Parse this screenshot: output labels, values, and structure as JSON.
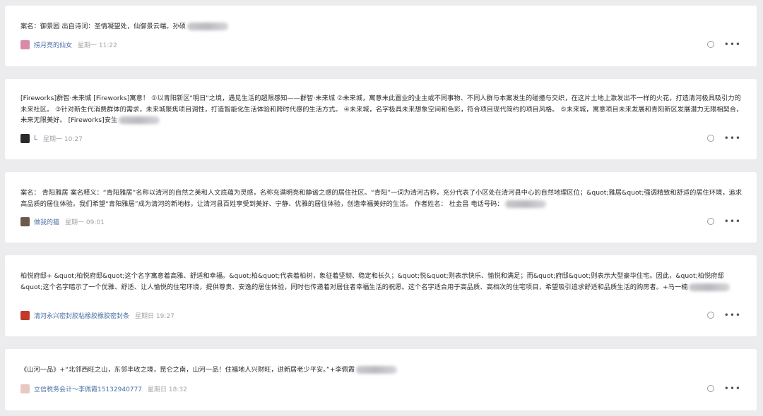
{
  "comments": [
    {
      "text": "案名：御景园 出自诗词：圣情凝望处，仙御景云端。孙硕",
      "author": "捞月亮的仙女",
      "time": "星期一 11:22",
      "avatar_color": "#d98aa8"
    },
    {
      "text": "[Fireworks]群智·未来城 [Fireworks]寓意！ ①以青阳新区\"明日\"之境，遇见生活的超限感知——群智·未来城 ②未来城，寓意未此置业的业主或不同事物、不同人群与本案发生的碰撞与交织，在这片土地上激发出不一样的火花，打造清河极具吸引力的未来社区。 ③针对新生代消费群体的需求，未来城聚焦项目调性，打造智能化生活体验和跨时代感的生活方式。 ④未来城，名字极具未来想象空间和色彩，符合项目现代简约的项目风格。 ⑤未来城，寓意项目未来发展和青阳新区发展潜力无限相契合，未来无限美好。 [Fireworks]安生",
      "author": "L",
      "time": "星期一 10:27",
      "avatar_color": "#2a2a2a"
    },
    {
      "text": "案名： 青阳雅居 案名释义：“青阳雅居”名称以清河的自然之美和人文底蕴为灵感，名称充满明亮和静谧之感的居住社区。“青阳”一词为清河古称，充分代表了小区处在清河县中心的自然地理区位；&quot;雅居&quot;强调精致和舒适的居住环境，追求高品质的居住体验。我们希望“青阳雅居”成为清河的新地标，让清河县百姓享受到美好、宁静、优雅的居住体验，创造幸福美好的生活。 作者姓名： 杜金昌 电话号码：",
      "author": "做我的猫",
      "time": "星期一 09:01",
      "avatar_color": "#6b5a4a"
    },
    {
      "text": "柏悦府邸+ &quot;柏悦府邸&quot;这个名字寓意着高雅、舒适和幸福。&quot;柏&quot;代表着柏树，象征着坚韧、稳定和长久；&quot;悦&quot;则表示快乐、愉悦和满足；而&quot;府邸&quot;则表示大型豪华住宅。因此，&quot;柏悦府邸&quot;这个名字暗示了一个优雅、舒适、让人愉悦的住宅环境，提供尊贵、安逸的居住体验，同时也传递着对居住者幸福生活的祝愿。这个名字适合用于高品质、高档次的住宅项目，希望吸引追求舒适和品质生活的购房者。+马一楠",
      "author": "清河永兴密封胶粘橡胶橡胶密封条",
      "time": "星期日 19:27",
      "avatar_color": "#c0392b"
    },
    {
      "text": "《山河一品》+“北邻西旺之山，东邻丰收之境，昆仑之南，山河一品！住福地人兴财旺，进新居老少平安。”+李佩霞",
      "author": "立信税务会计～李佩霞15132940777",
      "time": "星期日 18:32",
      "avatar_color": "#e8c9c2"
    }
  ]
}
